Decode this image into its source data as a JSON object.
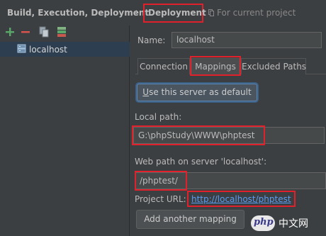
{
  "header": {
    "breadcrumb_parent": "Build, Execution, Deployment",
    "breadcrumb_separator": "›",
    "breadcrumb_current": "Deployment",
    "scope_text": "For current project"
  },
  "toolbar": {
    "add_icon": "plus-icon",
    "remove_icon": "minus-icon",
    "copy_icon": "copy-icon",
    "default_icon": "use-as-default-icon"
  },
  "server_list": {
    "items": [
      {
        "label": "localhost",
        "icon": "server-icon"
      }
    ]
  },
  "form": {
    "name_label": "Name:",
    "name_value": "localhost",
    "tabs": [
      {
        "label": "Connection"
      },
      {
        "label": "Mappings",
        "selected": true
      },
      {
        "label": "Excluded Paths"
      }
    ],
    "default_button_prefix": "",
    "default_button_mnemonic": "U",
    "default_button_rest": "se this server as default",
    "local_path_label": "Local path:",
    "local_path_value": "G:\\phpStudy\\WWW\\phptest",
    "web_path_label": "Web path on server 'localhost':",
    "web_path_value": "/phptest/",
    "project_url_label": "Project URL:",
    "project_url_value": "http://localhost/phptest",
    "add_mapping_button": "Add another mapping"
  },
  "watermark": {
    "logo_text": "php",
    "text": "中文网"
  },
  "colors": {
    "background": "#3c3f41",
    "highlight_box": "#e0202a",
    "link": "#589df6",
    "selection": "#2c3e50"
  }
}
